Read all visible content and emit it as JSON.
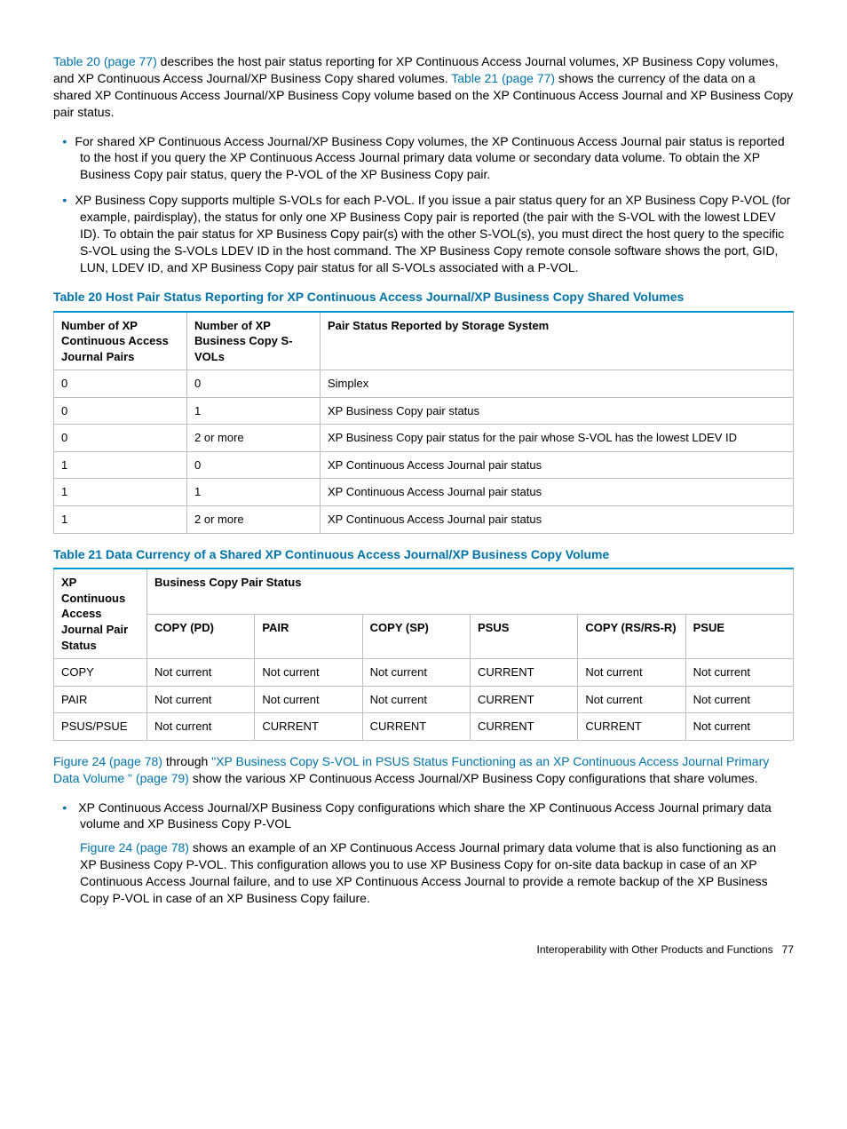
{
  "intro": {
    "link1": "Table 20 (page 77)",
    "text1a": " describes the host pair status reporting for XP Continuous Access Journal volumes, XP Business Copy volumes, and XP Continuous Access Journal/XP Business Copy shared volumes. ",
    "link2": "Table 21 (page 77)",
    "text1b": " shows the currency of the data on a shared XP Continuous Access Journal/XP Business Copy volume based on the XP Continuous Access Journal and XP Business Copy pair status."
  },
  "bullets1": [
    "For shared XP Continuous Access Journal/XP Business Copy volumes, the XP Continuous Access Journal pair status is reported to the host if you query the XP Continuous Access Journal primary data volume or secondary data volume. To obtain the XP Business Copy pair status, query the P-VOL of the XP Business Copy pair.",
    "XP Business Copy supports multiple S-VOLs for each P-VOL. If you issue a pair status query for an XP Business Copy P-VOL (for example, pairdisplay), the status for only one XP Business Copy pair is reported (the pair with the S-VOL with the lowest LDEV ID). To obtain the pair status for XP Business Copy pair(s) with the other S-VOL(s), you must direct the host query to the specific S-VOL using the S-VOLs LDEV ID in the host command. The XP Business Copy remote console software shows the port, GID, LUN, LDEV ID, and XP Business Copy pair status for all S-VOLs associated with a P-VOL."
  ],
  "table20": {
    "title": "Table 20 Host Pair Status Reporting for XP Continuous Access Journal/XP Business Copy Shared Volumes",
    "headers": [
      "Number of XP Continuous Access Journal Pairs",
      "Number of XP Business Copy S-VOLs",
      "Pair Status Reported by Storage System"
    ],
    "rows": [
      [
        "0",
        "0",
        "Simplex"
      ],
      [
        "0",
        "1",
        "XP Business Copy pair status"
      ],
      [
        "0",
        "2 or more",
        "XP Business Copy pair status for the pair whose S-VOL has the lowest LDEV ID"
      ],
      [
        "1",
        "0",
        "XP Continuous Access Journal pair status"
      ],
      [
        "1",
        "1",
        "XP Continuous Access Journal pair status"
      ],
      [
        "1",
        "2 or more",
        "XP Continuous Access Journal pair status"
      ]
    ]
  },
  "table21": {
    "title": "Table 21 Data Currency of a Shared XP Continuous Access Journal/XP Business Copy Volume",
    "header_left": "XP Continuous Access Journal Pair Status",
    "header_group": "Business Copy Pair Status",
    "subheaders": [
      "COPY (PD)",
      "PAIR",
      "COPY (SP)",
      "PSUS",
      "COPY (RS/RS-R)",
      "PSUE"
    ],
    "rows": [
      [
        "COPY",
        "Not current",
        "Not current",
        "Not current",
        "CURRENT",
        "Not current",
        "Not current"
      ],
      [
        "PAIR",
        "Not current",
        "Not current",
        "Not current",
        "CURRENT",
        "Not current",
        "Not current"
      ],
      [
        "PSUS/PSUE",
        "Not current",
        "CURRENT",
        "CURRENT",
        "CURRENT",
        "CURRENT",
        "Not current"
      ]
    ]
  },
  "mid": {
    "link1": "Figure 24 (page 78)",
    "text1": " through ",
    "link2": "\"XP Business Copy S-VOL in PSUS Status Functioning as an XP Continuous Access Journal Primary Data Volume \" (page 79)",
    "text2": " show the various XP Continuous Access Journal/XP Business Copy configurations that share volumes."
  },
  "bullets2": {
    "item1": "XP Continuous Access Journal/XP Business Copy configurations which share the XP Continuous Access Journal primary data volume and XP Business Copy P-VOL",
    "sub_link": "Figure 24 (page 78)",
    "sub_text": " shows an example of an XP Continuous Access Journal primary data volume that is also functioning as an XP Business Copy P-VOL. This configuration allows you to use XP Business Copy for on-site data backup in case of an XP Continuous Access Journal failure, and to use XP Continuous Access Journal to provide a remote backup of the XP Business Copy P-VOL in case of an XP Business Copy failure."
  },
  "footer": {
    "text": "Interoperability with Other Products and Functions",
    "page": "77"
  }
}
